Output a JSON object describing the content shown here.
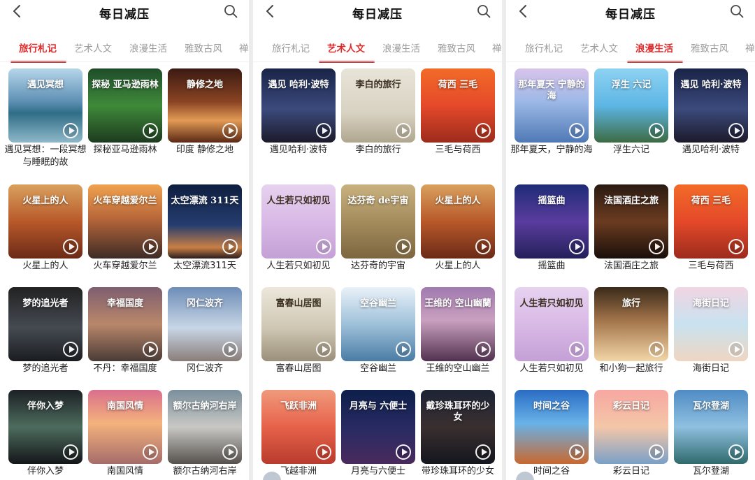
{
  "app": {
    "title": "每日减压",
    "tabs": [
      "旅行札记",
      "艺术人文",
      "浪漫生活",
      "雅致古风",
      "禅"
    ]
  },
  "panels": [
    {
      "active_tab": 0,
      "items": [
        {
          "label": "遇见冥想：一段冥想与睡眠的故",
          "thumb_text": "遇见冥想",
          "bg": "g-lake"
        },
        {
          "label": "探秘亚马逊雨林",
          "thumb_text": "探秘 亚马逊雨林",
          "bg": "g-forest"
        },
        {
          "label": "印度 静修之地",
          "thumb_text": "静修之地",
          "bg": "g-zen"
        },
        {
          "label": "火星上的人",
          "thumb_text": "火星上的人",
          "bg": "g-mars"
        },
        {
          "label": "火车穿越爱尔兰",
          "thumb_text": "火车穿越爱尔兰",
          "bg": "g-train"
        },
        {
          "label": "太空漂流311天",
          "thumb_text": "太空漂流 311天",
          "bg": "g-space"
        },
        {
          "label": "梦的追光者",
          "thumb_text": "梦的追光者",
          "bg": "g-dream"
        },
        {
          "label": "不丹：幸福国度",
          "thumb_text": "幸福国度",
          "bg": "g-bhutan"
        },
        {
          "label": "冈仁波齐",
          "thumb_text": "冈仁波齐",
          "bg": "g-snow"
        },
        {
          "label": "伴你入梦",
          "thumb_text": "伴你入梦",
          "bg": "g-dream2"
        },
        {
          "label": "南国风情",
          "thumb_text": "南国风情",
          "bg": "g-nanguo"
        },
        {
          "label": "额尔古纳河右岸",
          "thumb_text": "额尔古纳河右岸",
          "bg": "g-erguna"
        }
      ]
    },
    {
      "active_tab": 1,
      "items": [
        {
          "label": "遇见哈利·波特",
          "thumb_text": "遇见 哈利·波特",
          "bg": "g-harry"
        },
        {
          "label": "李白的旅行",
          "thumb_text": "李白的旅行",
          "bg": "g-libai",
          "dark": true
        },
        {
          "label": "三毛与荷西",
          "thumb_text": "荷西 三毛",
          "bg": "g-sanmao"
        },
        {
          "label": "人生若只如初见",
          "thumb_text": "人生若只如初见",
          "bg": "g-pink",
          "dark": true
        },
        {
          "label": "达芬奇的宇宙",
          "thumb_text": "达芬奇 de宇宙",
          "bg": "g-davinci"
        },
        {
          "label": "火星上的人",
          "thumb_text": "火星上的人",
          "bg": "g-mars"
        },
        {
          "label": "富春山居图",
          "thumb_text": "富春山居图",
          "bg": "g-fuchun",
          "dark": true
        },
        {
          "label": "空谷幽兰",
          "thumb_text": "空谷幽兰",
          "bg": "g-orchid"
        },
        {
          "label": "王维的空山幽兰",
          "thumb_text": "王维的 空山幽蘭",
          "bg": "g-wangwei"
        },
        {
          "label": "飞越非洲",
          "thumb_text": "飞跃非洲",
          "bg": "g-africa"
        },
        {
          "label": "月亮与六便士",
          "thumb_text": "月亮与 六便士",
          "bg": "g-moon"
        },
        {
          "label": "带珍珠耳环的少女",
          "thumb_text": "戴珍珠耳环的少女",
          "bg": "g-pearl"
        }
      ]
    },
    {
      "active_tab": 2,
      "items": [
        {
          "label": "那年夏天，宁静的海",
          "thumb_text": "那年夏天 宁静的海",
          "bg": "g-summer"
        },
        {
          "label": "浮生六记",
          "thumb_text": "浮生 六记",
          "bg": "g-fusheng"
        },
        {
          "label": "遇见哈利·波特",
          "thumb_text": "遇见 哈利·波特",
          "bg": "g-harry"
        },
        {
          "label": "摇篮曲",
          "thumb_text": "摇篮曲",
          "bg": "g-lullaby"
        },
        {
          "label": "法国酒庄之旅",
          "thumb_text": "法国酒庄之旅",
          "bg": "g-wine"
        },
        {
          "label": "三毛与荷西",
          "thumb_text": "荷西 三毛",
          "bg": "g-sanmao"
        },
        {
          "label": "人生若只如初见",
          "thumb_text": "人生若只如初见",
          "bg": "g-pink",
          "dark": true
        },
        {
          "label": "和小狗一起旅行",
          "thumb_text": "旅行",
          "bg": "g-dog"
        },
        {
          "label": "海街日记",
          "thumb_text": "海街日记",
          "bg": "g-beach"
        },
        {
          "label": "时间之谷",
          "thumb_text": "时间之谷",
          "bg": "g-time"
        },
        {
          "label": "彩云日记",
          "thumb_text": "彩云日记",
          "bg": "g-cloud"
        },
        {
          "label": "瓦尔登湖",
          "thumb_text": "瓦尔登湖",
          "bg": "g-walden"
        }
      ]
    }
  ],
  "icons": {
    "back": "chevron-left-icon",
    "search": "search-icon",
    "play": "play-circle-icon"
  },
  "colors": {
    "accent": "#e02a2a",
    "tab_inactive": "#9a9a9a",
    "title": "#111111"
  }
}
